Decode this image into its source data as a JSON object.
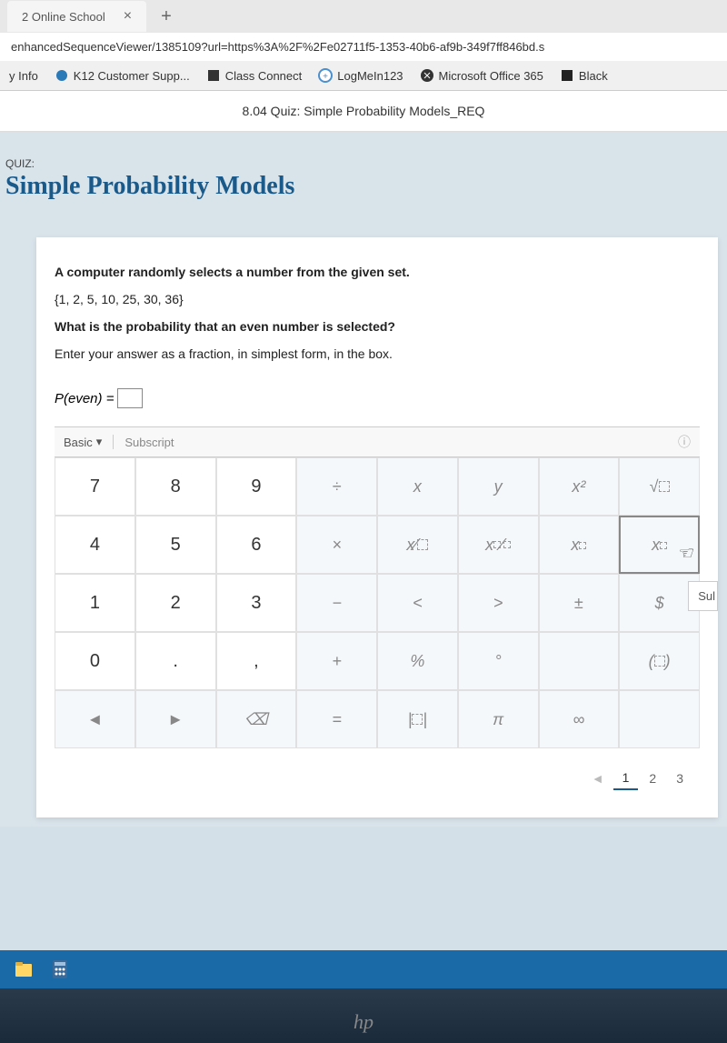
{
  "browser": {
    "tab_title": "2 Online School",
    "url": "enhancedSequenceViewer/1385109?url=https%3A%2F%2Fe02711f5-1353-40b6-af9b-349f7ff846bd.s"
  },
  "bookmarks": {
    "items": [
      "y Info",
      "K12 Customer Supp...",
      "Class Connect",
      "LogMeIn123",
      "Microsoft Office 365",
      "Black"
    ]
  },
  "quiz": {
    "header": "8.04 Quiz: Simple Probability Models_REQ",
    "label": "QUIZ:",
    "title": "Simple Probability Models"
  },
  "question": {
    "line1": "A computer randomly selects a number from the given set.",
    "line2": "{1, 2, 5, 10, 25, 30, 36}",
    "line3": "What is the probability that an even number is selected?",
    "line4": "Enter your answer as a fraction, in simplest form, in the box.",
    "answer_label": "P(even) ="
  },
  "calculator": {
    "mode": "Basic",
    "tab2": "Subscript",
    "rows": [
      [
        "7",
        "8",
        "9",
        "÷",
        "x",
        "y",
        "x²",
        "√□"
      ],
      [
        "4",
        "5",
        "6",
        "×",
        "x/□",
        "x □/□",
        "x^□",
        "x□"
      ],
      [
        "1",
        "2",
        "3",
        "−",
        "<",
        ">",
        "±",
        "$"
      ],
      [
        "0",
        ".",
        ",",
        "+",
        "%",
        "°",
        "",
        "(□)"
      ],
      [
        "◄",
        "►",
        "⌫",
        "=",
        "|□|",
        "π",
        "∞",
        ""
      ]
    ]
  },
  "submit_peek": "Sul",
  "pagination": {
    "pages": [
      "1",
      "2",
      "3"
    ],
    "active": 0
  },
  "hp": "hp"
}
